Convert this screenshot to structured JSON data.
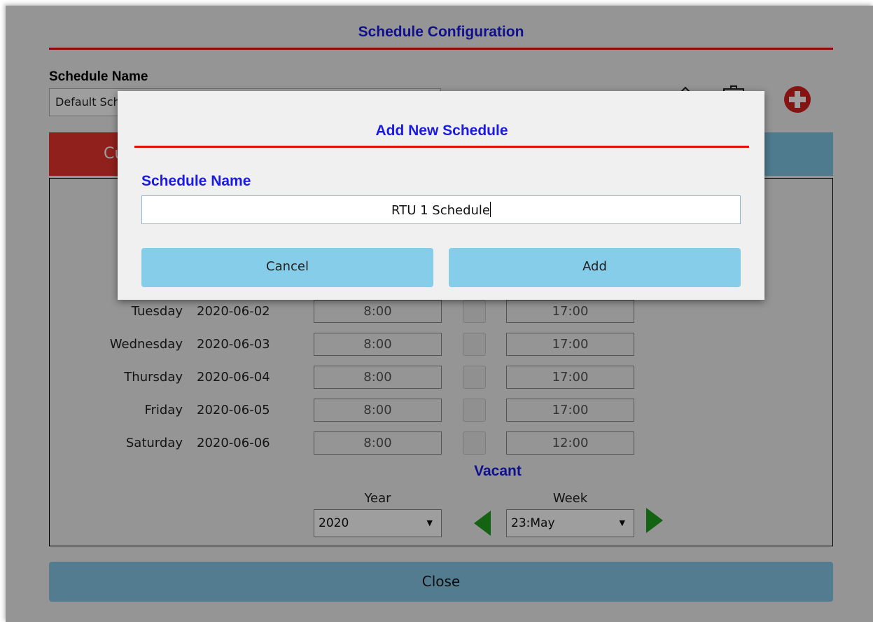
{
  "window": {
    "title": "Schedule Configuration"
  },
  "schedule_name": {
    "label": "Schedule Name",
    "selected_value": "Default Schedule"
  },
  "toolbar": {
    "edit_icon": "pencil-icon",
    "delete_icon": "trash-icon",
    "add_icon": "plus-circle-icon",
    "add_color": "#d81e1e"
  },
  "tabs": {
    "active_label": "Current"
  },
  "schedule_rows": [
    {
      "day": "Tuesday",
      "date": "2020-06-02",
      "start": "8:00",
      "end": "17:00"
    },
    {
      "day": "Wednesday",
      "date": "2020-06-03",
      "start": "8:00",
      "end": "17:00"
    },
    {
      "day": "Thursday",
      "date": "2020-06-04",
      "start": "8:00",
      "end": "17:00"
    },
    {
      "day": "Friday",
      "date": "2020-06-05",
      "start": "8:00",
      "end": "17:00"
    },
    {
      "day": "Saturday",
      "date": "2020-06-06",
      "start": "8:00",
      "end": "12:00"
    }
  ],
  "vacant": {
    "label": "Vacant",
    "year_label": "Year",
    "year_value": "2020",
    "week_label": "Week",
    "week_value": "23:May"
  },
  "close_label": "Close",
  "modal": {
    "title": "Add New Schedule",
    "field_label": "Schedule Name",
    "field_value": "RTU 1 Schedule",
    "cancel_label": "Cancel",
    "add_label": "Add"
  },
  "colors": {
    "accent_blue": "#1a1ae6",
    "rule_red": "#e01010",
    "button_blue": "#86cdea",
    "tab_red": "#e8352e",
    "arrow_green": "#1fa01f"
  }
}
